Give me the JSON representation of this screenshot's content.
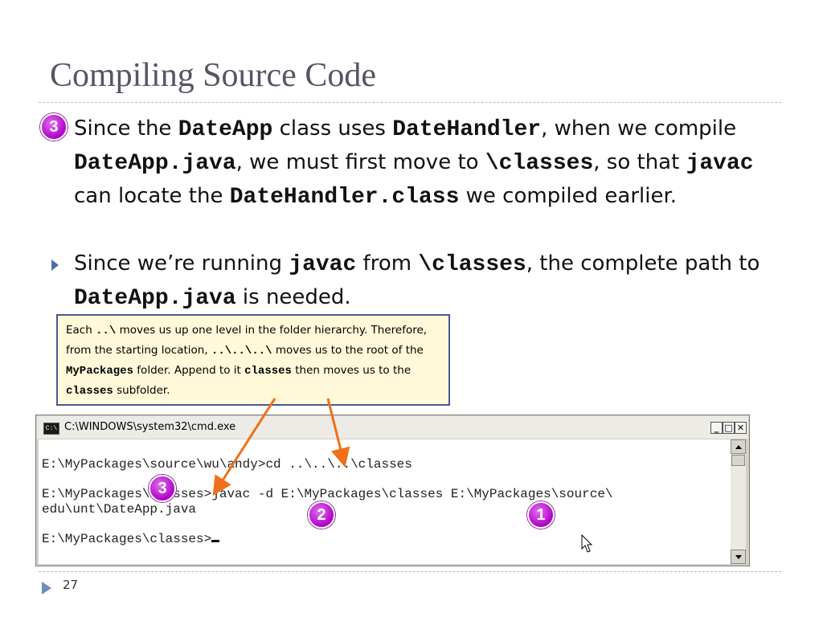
{
  "slide": {
    "title": "Compiling Source Code",
    "page_number": "27"
  },
  "bullets": {
    "first": {
      "badge": "3",
      "t1": "Since the ",
      "c1": "DateApp",
      "t2": " class uses ",
      "c2": "DateHandler",
      "t3": ", when we compile ",
      "c3": "DateApp.java",
      "t4": ", we must first move to ",
      "c4": "\\classes",
      "t5": ", so that ",
      "c5": "javac",
      "t6": " can locate the ",
      "c6": "DateHandler.class",
      "t7": " we compiled earlier."
    },
    "second": {
      "t1": "Since we’re running ",
      "c1": "javac",
      "t2": " from ",
      "c2": "\\classes",
      "t3": ", the complete path to ",
      "c3": "DateApp.java",
      "t4": " is needed."
    }
  },
  "callout": {
    "t1": "Each ",
    "c1": "..\\",
    "t2": " moves us up one level in the folder hierarchy. Therefore, from the starting location, ",
    "c2": "..\\..\\..\\",
    "t3": " moves us to the root of the ",
    "c3": "MyPackages",
    "t4": " folder.  Append to it ",
    "c4": "classes",
    "t5": " then moves us to the ",
    "c5": "classes",
    "t6": " subfolder."
  },
  "cmd_window": {
    "title": "C:\\WINDOWS\\system32\\cmd.exe",
    "icon_text": "C:\\",
    "buttons": {
      "minimize": "_",
      "maximize": "□",
      "close": "✕"
    },
    "lines": [
      "E:\\MyPackages\\source\\wu\\andy>cd ..\\..\\..\\classes",
      "E:\\MyPackages\\classes>javac -d E:\\MyPackages\\classes E:\\MyPackages\\source\\",
      "edu\\unt\\DateApp.java",
      "E:\\MyPackages\\classes>"
    ]
  },
  "annotations": {
    "badge_1": "1",
    "badge_2": "2",
    "badge_3": "3"
  },
  "colors": {
    "title": "#555565",
    "badge": "#b000c8",
    "arrow": "#f07018",
    "callout_bg": "#fff9d9",
    "callout_border": "#4a5890",
    "bullet_arrow": "#4a6fa5"
  },
  "icons": {
    "bullet": "triangle-right-icon",
    "cmd": "console-icon",
    "pointer": "mouse-pointer-icon"
  }
}
